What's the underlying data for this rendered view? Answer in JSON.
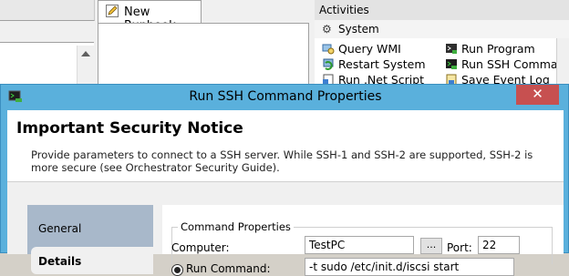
{
  "background": {
    "runbook_tab": {
      "label": "New Runbook",
      "icon": "pencil-icon"
    },
    "activities": {
      "header": "Activities",
      "category": "System",
      "items": [
        {
          "label": "Query WMI",
          "icon": "query-wmi-icon"
        },
        {
          "label": "Run Program",
          "icon": "run-program-icon"
        },
        {
          "label": "Restart System",
          "icon": "restart-system-icon"
        },
        {
          "label": "Run SSH Command",
          "icon": "run-ssh-command-icon"
        },
        {
          "label": "Run .Net Script",
          "icon": "run-net-script-icon"
        },
        {
          "label": "Save Event Log",
          "icon": "save-event-log-icon"
        }
      ]
    }
  },
  "dialog": {
    "title": "Run SSH Command Properties",
    "close_label": "✕",
    "notice": {
      "heading": "Important Security Notice",
      "text": "Provide parameters to connect to a SSH server. While SSH-1 and SSH-2 are supported, SSH-2 is more secure (see Orchestrator Security Guide)."
    },
    "nav": [
      {
        "label": "General"
      },
      {
        "label": "Details",
        "selected": true
      }
    ],
    "command_properties": {
      "group_title": "Command Properties",
      "computer_label": "Computer:",
      "computer_value": "TestPC",
      "browse_label": "...",
      "port_label": "Port:",
      "port_value": "22",
      "run_command_label": "Run Command:",
      "run_command_value": "-t sudo /etc/init.d/iscsi start"
    }
  },
  "colors": {
    "dialog_frame": "#5ab0dc",
    "close_button": "#c75050",
    "nav_background": "#a8b8ca"
  }
}
